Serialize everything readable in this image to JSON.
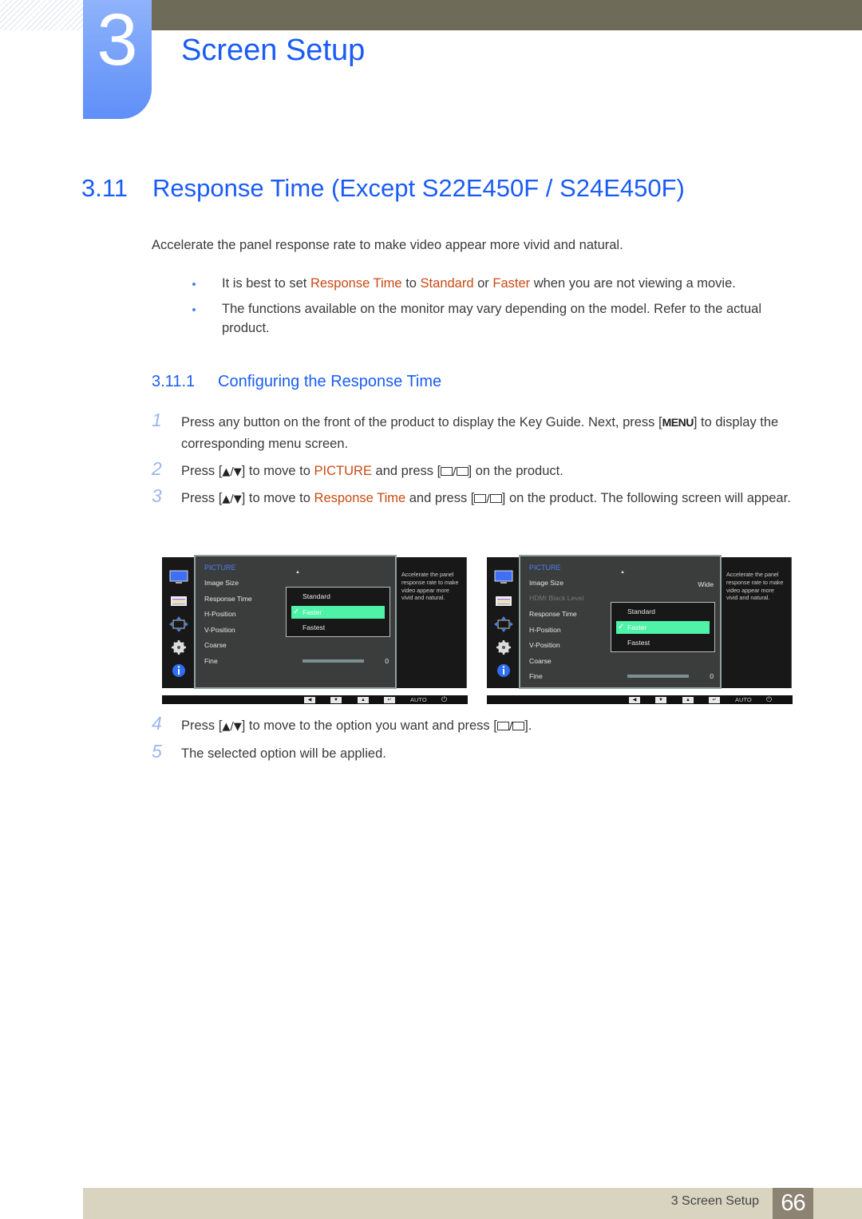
{
  "header": {
    "chapter_number": "3",
    "chapter_title": "Screen Setup"
  },
  "section": {
    "number": "3.11",
    "title": "Response Time (Except S22E450F / S24E450F)",
    "intro": "Accelerate the panel response rate to make video appear more vivid and natural.",
    "notes": [
      {
        "parts": [
          {
            "t": "It is best to set ",
            "hl": false
          },
          {
            "t": "Response Time",
            "hl": true
          },
          {
            "t": " to ",
            "hl": false
          },
          {
            "t": "Standard",
            "hl": true
          },
          {
            "t": " or ",
            "hl": false
          },
          {
            "t": "Faster",
            "hl": true
          },
          {
            "t": " when you are not viewing a movie.",
            "hl": false
          }
        ]
      },
      {
        "parts": [
          {
            "t": "The functions available on the monitor may vary depending on the model. Refer to the actual product.",
            "hl": false
          }
        ]
      }
    ]
  },
  "subsection": {
    "number": "3.11.1",
    "title": "Configuring the Response Time"
  },
  "steps": [
    {
      "n": "1",
      "before": "Press any button on the front of the product to display the Key Guide. Next, press [",
      "key": "MENU",
      "after": "] to display the corresponding menu screen."
    },
    {
      "n": "2",
      "a": "Press [",
      "arrows": "▲/▼",
      "b": "] to move to ",
      "hl": "PICTURE",
      "c": " and press [",
      "d": "] on the product."
    },
    {
      "n": "3",
      "a": "Press [",
      "arrows": "▲/▼",
      "b": "] to move to ",
      "hl": "Response Time",
      "c": " and press [",
      "d": "] on the product. The following screen will appear."
    },
    {
      "n": "4",
      "a": "Press [",
      "arrows": "▲/▼",
      "b": "] to move to the option you want and press [",
      "d": "]."
    },
    {
      "n": "5",
      "text": "The selected option will be applied."
    }
  ],
  "osd_screens": [
    {
      "menu_title": "PICTURE",
      "items": [
        {
          "label": "Image Size",
          "value": "",
          "dim": false
        },
        {
          "label": "Response Time",
          "value": "",
          "dim": false
        },
        {
          "label": "H-Position",
          "value": "",
          "dim": false
        },
        {
          "label": "V-Position",
          "value": "",
          "dim": false
        },
        {
          "label": "Coarse",
          "value": "",
          "dim": false
        },
        {
          "label": "Fine",
          "value": "0",
          "dim": false
        }
      ],
      "popup_options": [
        {
          "label": "Standard",
          "selected": false
        },
        {
          "label": "Faster",
          "selected": true
        },
        {
          "label": "Fastest",
          "selected": false
        }
      ],
      "fine_slider_fraction": 1.0,
      "description": "Accelerate the panel response rate to make video appear more vivid and natural.",
      "bar_auto": "AUTO"
    },
    {
      "menu_title": "PICTURE",
      "items": [
        {
          "label": "Image Size",
          "value": "Wide",
          "dim": false
        },
        {
          "label": "HDMI Black Level",
          "value": "",
          "dim": true
        },
        {
          "label": "Response Time",
          "value": "",
          "dim": false
        },
        {
          "label": "H-Position",
          "value": "",
          "dim": false
        },
        {
          "label": "V-Position",
          "value": "",
          "dim": false
        },
        {
          "label": "Coarse",
          "value": "",
          "dim": false
        },
        {
          "label": "Fine",
          "value": "0",
          "dim": false
        }
      ],
      "popup_options": [
        {
          "label": "Standard",
          "selected": false
        },
        {
          "label": "Faster",
          "selected": true
        },
        {
          "label": "Fastest",
          "selected": false
        }
      ],
      "fine_slider_fraction": 1.0,
      "description": "Accelerate the panel response rate to make video appear more vivid and natural.",
      "bar_auto": "AUTO"
    }
  ],
  "footer": {
    "label": "3 Screen Setup",
    "page": "66"
  },
  "colors": {
    "heading_blue": "#1a5cf5",
    "highlight_orange": "#c84a12",
    "osd_selected": "#4ff3a8"
  }
}
